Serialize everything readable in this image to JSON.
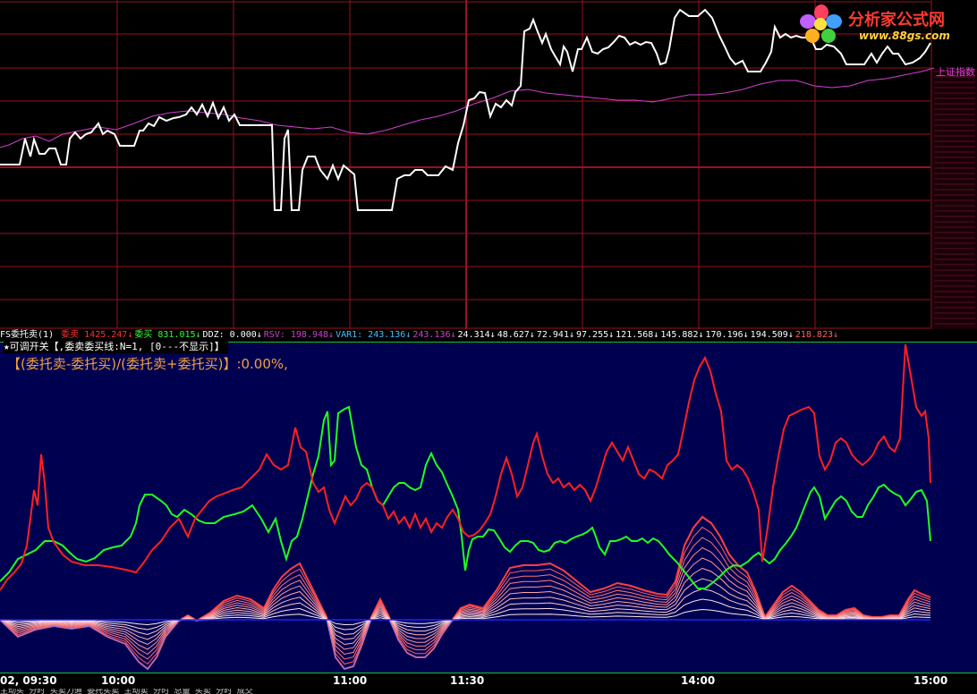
{
  "logo": {
    "title": "分析家公式网",
    "url": "www.88gs.com"
  },
  "price_chart": {
    "index_label": "上证指数",
    "colors": {
      "grid": "#9a1020",
      "price_line": "#ffffff",
      "index_line": "#d040d0"
    }
  },
  "indicator_bar": {
    "name": "FS委托卖(1)",
    "items": [
      {
        "label": "委卖",
        "value": "1425.247↓",
        "color": "#ff3030"
      },
      {
        "label": "委买",
        "value": "831.015↓",
        "color": "#30ff30"
      },
      {
        "label": "DDZ:",
        "value": "0.000↓",
        "color": "#ffffff"
      },
      {
        "label": "RSV:",
        "value": "198.948↓",
        "color": "#d040d0"
      },
      {
        "label": "VAR1:",
        "value": "243.136↓",
        "color": "#40c0ff"
      },
      {
        "label": "",
        "value": "243.136↓",
        "color": "#d040d0"
      },
      {
        "label": "",
        "value": "24.314↓",
        "color": "#ffffff"
      },
      {
        "label": "",
        "value": "48.627↓",
        "color": "#ffffff"
      },
      {
        "label": "",
        "value": "72.941↓",
        "color": "#ffffff"
      },
      {
        "label": "",
        "value": "97.255↓",
        "color": "#ffffff"
      },
      {
        "label": "",
        "value": "121.568↓",
        "color": "#ffffff"
      },
      {
        "label": "",
        "value": "145.882↓",
        "color": "#ffffff"
      },
      {
        "label": "",
        "value": "170.196↓",
        "color": "#ffffff"
      },
      {
        "label": "",
        "value": "194.509↓",
        "color": "#ffffff"
      },
      {
        "label": "",
        "value": "218.823↓",
        "color": "#ff6060"
      }
    ]
  },
  "param_line": "★可调开关【,委卖委买线:N=1, [0---不显示]】",
  "formula": "【(委托卖-委托买)/(委托卖+委托买)】:0.00%,",
  "indicator_panel": {
    "colors": {
      "background": "#000050",
      "sell_line": "#ff2020",
      "buy_line": "#20ff20",
      "baseline": "#2020ff"
    }
  },
  "time_axis": {
    "labels": [
      "02, 09:30",
      "10:00",
      "11:00",
      "11:30",
      "14:00",
      "15:00"
    ]
  },
  "status_strip": "主动买 分时 买卖力道 委托买卖 主动卖 分时 总量 买卖 分时 成交"
}
